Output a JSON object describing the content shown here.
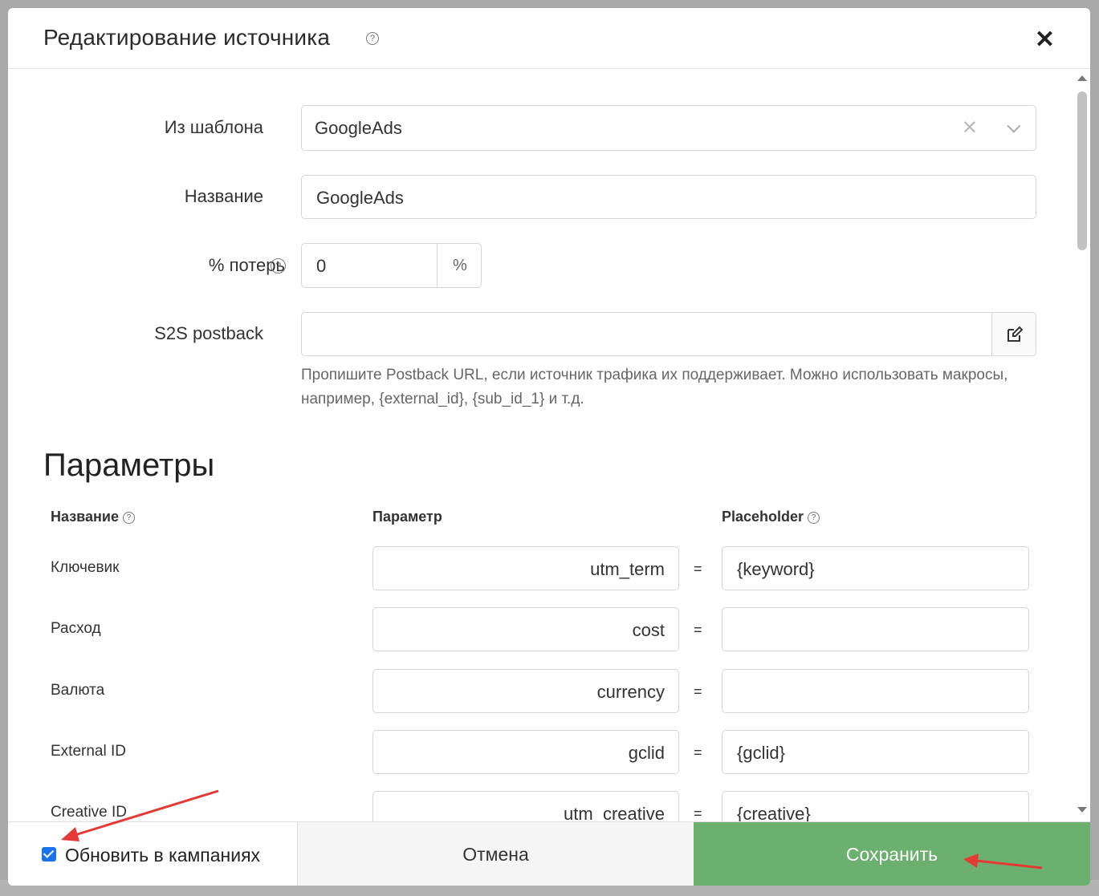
{
  "modal": {
    "title": "Редактирование источника",
    "help_icon": "?",
    "close_icon": "✕"
  },
  "form": {
    "template_label": "Из шаблона",
    "template_value": "GoogleAds",
    "name_label": "Название",
    "name_value": "GoogleAds",
    "loss_label": "% потерь",
    "loss_value": "0",
    "loss_unit": "%",
    "s2s_label": "S2S postback",
    "s2s_value": "",
    "s2s_hint": "Пропишите Postback URL, если источник трафика их поддерживает. Можно использовать макросы, например, {external_id}, {sub_id_1} и т.д."
  },
  "params": {
    "title": "Параметры",
    "headers": {
      "name": "Название",
      "param": "Параметр",
      "placeholder": "Placeholder"
    },
    "rows": [
      {
        "name": "Ключевик",
        "param": "utm_term",
        "eq": "=",
        "placeholder": "{keyword}"
      },
      {
        "name": "Расход",
        "param": "cost",
        "eq": "=",
        "placeholder": ""
      },
      {
        "name": "Валюта",
        "param": "currency",
        "eq": "=",
        "placeholder": ""
      },
      {
        "name": "External ID",
        "param": "gclid",
        "eq": "=",
        "placeholder": "{gclid}"
      },
      {
        "name": "Creative ID",
        "param": "utm_creative",
        "eq": "=",
        "placeholder": "{creative}"
      }
    ]
  },
  "footer": {
    "update_label": "Обновить в кампаниях",
    "update_checked": true,
    "cancel_label": "Отмена",
    "save_label": "Сохранить"
  },
  "colors": {
    "save_button": "#6bb06f",
    "checkbox": "#1a73e8",
    "annotation_arrow": "#e53935"
  }
}
